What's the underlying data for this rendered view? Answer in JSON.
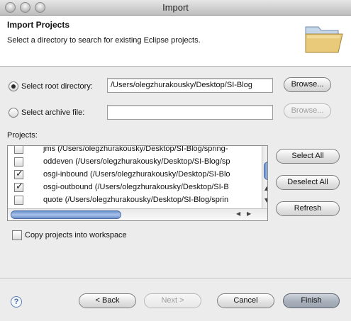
{
  "window": {
    "title": "Import"
  },
  "header": {
    "title": "Import Projects",
    "description": "Select a directory to search for existing Eclipse projects.",
    "icon": "folder-icon"
  },
  "root_directory": {
    "label": "Select root directory:",
    "selected": true,
    "value": "/Users/olegzhurakousky/Desktop/SI-Blog",
    "browse_label": "Browse..."
  },
  "archive_file": {
    "label": "Select archive file:",
    "selected": false,
    "value": "",
    "browse_label": "Browse..."
  },
  "projects": {
    "label": "Projects:",
    "items": [
      {
        "text": "jms (/Users/olegzhurakousky/Desktop/SI-Blog/spring-",
        "checked": false
      },
      {
        "text": "oddeven (/Users/olegzhurakousky/Desktop/SI-Blog/sp",
        "checked": false
      },
      {
        "text": "osgi-inbound (/Users/olegzhurakousky/Desktop/SI-Blo",
        "checked": true
      },
      {
        "text": "osgi-outbound (/Users/olegzhurakousky/Desktop/SI-B",
        "checked": true
      },
      {
        "text": "quote (/Users/olegzhurakousky/Desktop/SI-Blog/sprin",
        "checked": false
      }
    ],
    "select_all_label": "Select All",
    "deselect_all_label": "Deselect All",
    "refresh_label": "Refresh"
  },
  "copy_projects": {
    "label": "Copy projects into workspace",
    "checked": false
  },
  "footer": {
    "help_label": "?",
    "back_label": "< Back",
    "next_label": "Next >",
    "cancel_label": "Cancel",
    "finish_label": "Finish"
  }
}
